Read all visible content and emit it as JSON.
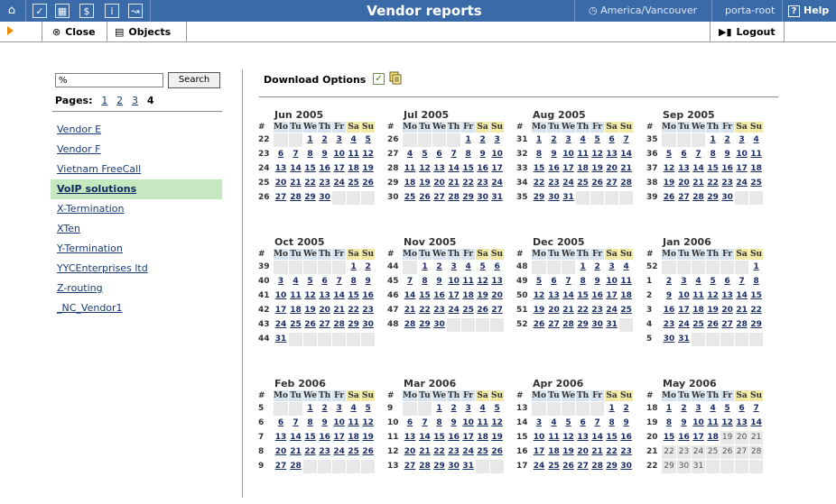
{
  "header": {
    "title": "Vendor reports",
    "timezone": "America/Vancouver",
    "user": "porta-root",
    "help": "Help"
  },
  "toolbar": {
    "close": "Close",
    "objects": "Objects",
    "logout": "Logout"
  },
  "search": {
    "value": "%",
    "button": "Search"
  },
  "pagination": {
    "label": "Pages:",
    "pages": [
      "1",
      "2",
      "3"
    ],
    "current": "4"
  },
  "vendors": [
    "Vendor E",
    "Vendor F",
    "Vietnam FreeCall",
    "VoIP solutions",
    "X-Termination",
    "XTen",
    "Y-Termination",
    "YYCEnterprises ltd",
    "Z-routing",
    "_NC_Vendor1"
  ],
  "selected_vendor": "VoIP solutions",
  "download_options_label": "Download Options",
  "weekday_headers": [
    "#",
    "Mo",
    "Tu",
    "We",
    "Th",
    "Fr",
    "Sa",
    "Su"
  ],
  "months": [
    {
      "title": "Jun 2005",
      "weeks": [
        [
          "22",
          "",
          "",
          "1",
          "2",
          "3",
          "4",
          "5"
        ],
        [
          "23",
          "6",
          "7",
          "8",
          "9",
          "10",
          "11",
          "12"
        ],
        [
          "24",
          "13",
          "14",
          "15",
          "16",
          "17",
          "18",
          "19"
        ],
        [
          "25",
          "20",
          "21",
          "22",
          "23",
          "24",
          "25",
          "26"
        ],
        [
          "26",
          "27",
          "28",
          "29",
          "30",
          "",
          "",
          ""
        ]
      ]
    },
    {
      "title": "Jul 2005",
      "weeks": [
        [
          "26",
          "",
          "",
          "",
          "",
          "1",
          "2",
          "3"
        ],
        [
          "27",
          "4",
          "5",
          "6",
          "7",
          "8",
          "9",
          "10"
        ],
        [
          "28",
          "11",
          "12",
          "13",
          "14",
          "15",
          "16",
          "17"
        ],
        [
          "29",
          "18",
          "19",
          "20",
          "21",
          "22",
          "23",
          "24"
        ],
        [
          "30",
          "25",
          "26",
          "27",
          "28",
          "29",
          "30",
          "31"
        ]
      ]
    },
    {
      "title": "Aug 2005",
      "weeks": [
        [
          "31",
          "1",
          "2",
          "3",
          "4",
          "5",
          "6",
          "7"
        ],
        [
          "32",
          "8",
          "9",
          "10",
          "11",
          "12",
          "13",
          "14"
        ],
        [
          "33",
          "15",
          "16",
          "17",
          "18",
          "19",
          "20",
          "21"
        ],
        [
          "34",
          "22",
          "23",
          "24",
          "25",
          "26",
          "27",
          "28"
        ],
        [
          "35",
          "29",
          "30",
          "31",
          "",
          "",
          "",
          ""
        ]
      ]
    },
    {
      "title": "Sep 2005",
      "weeks": [
        [
          "35",
          "",
          "",
          "",
          "1",
          "2",
          "3",
          "4"
        ],
        [
          "36",
          "5",
          "6",
          "7",
          "8",
          "9",
          "10",
          "11"
        ],
        [
          "37",
          "12",
          "13",
          "14",
          "15",
          "16",
          "17",
          "18"
        ],
        [
          "38",
          "19",
          "20",
          "21",
          "22",
          "23",
          "24",
          "25"
        ],
        [
          "39",
          "26",
          "27",
          "28",
          "29",
          "30",
          "",
          ""
        ]
      ]
    },
    {
      "title": "Oct 2005",
      "weeks": [
        [
          "39",
          "",
          "",
          "",
          "",
          "",
          "1",
          "2"
        ],
        [
          "40",
          "3",
          "4",
          "5",
          "6",
          "7",
          "8",
          "9"
        ],
        [
          "41",
          "10",
          "11",
          "12",
          "13",
          "14",
          "15",
          "16"
        ],
        [
          "42",
          "17",
          "18",
          "19",
          "20",
          "21",
          "22",
          "23"
        ],
        [
          "43",
          "24",
          "25",
          "26",
          "27",
          "28",
          "29",
          "30"
        ],
        [
          "44",
          "31",
          "",
          "",
          "",
          "",
          "",
          ""
        ]
      ]
    },
    {
      "title": "Nov 2005",
      "weeks": [
        [
          "44",
          "",
          "1",
          "2",
          "3",
          "4",
          "5",
          "6"
        ],
        [
          "45",
          "7",
          "8",
          "9",
          "10",
          "11",
          "12",
          "13"
        ],
        [
          "46",
          "14",
          "15",
          "16",
          "17",
          "18",
          "19",
          "20"
        ],
        [
          "47",
          "21",
          "22",
          "23",
          "24",
          "25",
          "26",
          "27"
        ],
        [
          "48",
          "28",
          "29",
          "30",
          "",
          "",
          "",
          ""
        ]
      ]
    },
    {
      "title": "Dec 2005",
      "weeks": [
        [
          "48",
          "",
          "",
          "",
          "1",
          "2",
          "3",
          "4"
        ],
        [
          "49",
          "5",
          "6",
          "7",
          "8",
          "9",
          "10",
          "11"
        ],
        [
          "50",
          "12",
          "13",
          "14",
          "15",
          "16",
          "17",
          "18"
        ],
        [
          "51",
          "19",
          "20",
          "21",
          "22",
          "23",
          "24",
          "25"
        ],
        [
          "52",
          "26",
          "27",
          "28",
          "29",
          "30",
          "31",
          ""
        ]
      ]
    },
    {
      "title": "Jan 2006",
      "weeks": [
        [
          "52",
          "",
          "",
          "",
          "",
          "",
          "",
          "1"
        ],
        [
          "1",
          "2",
          "3",
          "4",
          "5",
          "6",
          "7",
          "8"
        ],
        [
          "2",
          "9",
          "10",
          "11",
          "12",
          "13",
          "14",
          "15"
        ],
        [
          "3",
          "16",
          "17",
          "18",
          "19",
          "20",
          "21",
          "22"
        ],
        [
          "4",
          "23",
          "24",
          "25",
          "26",
          "27",
          "28",
          "29"
        ],
        [
          "5",
          "30",
          "31",
          "",
          "",
          "",
          "",
          ""
        ]
      ]
    },
    {
      "title": "Feb 2006",
      "weeks": [
        [
          "5",
          "",
          "",
          "1",
          "2",
          "3",
          "4",
          "5"
        ],
        [
          "6",
          "6",
          "7",
          "8",
          "9",
          "10",
          "11",
          "12"
        ],
        [
          "7",
          "13",
          "14",
          "15",
          "16",
          "17",
          "18",
          "19"
        ],
        [
          "8",
          "20",
          "21",
          "22",
          "23",
          "24",
          "25",
          "26"
        ],
        [
          "9",
          "27",
          "28",
          "",
          "",
          "",
          "",
          ""
        ]
      ]
    },
    {
      "title": "Mar 2006",
      "weeks": [
        [
          "9",
          "",
          "",
          "1",
          "2",
          "3",
          "4",
          "5"
        ],
        [
          "10",
          "6",
          "7",
          "8",
          "9",
          "10",
          "11",
          "12"
        ],
        [
          "11",
          "13",
          "14",
          "15",
          "16",
          "17",
          "18",
          "19"
        ],
        [
          "12",
          "20",
          "21",
          "22",
          "23",
          "24",
          "25",
          "26"
        ],
        [
          "13",
          "27",
          "28",
          "29",
          "30",
          "31",
          "",
          ""
        ]
      ]
    },
    {
      "title": "Apr 2006",
      "weeks": [
        [
          "13",
          "",
          "",
          "",
          "",
          "",
          "1",
          "2"
        ],
        [
          "14",
          "3",
          "4",
          "5",
          "6",
          "7",
          "8",
          "9"
        ],
        [
          "15",
          "10",
          "11",
          "12",
          "13",
          "14",
          "15",
          "16"
        ],
        [
          "16",
          "17",
          "18",
          "19",
          "20",
          "21",
          "22",
          "23"
        ],
        [
          "17",
          "24",
          "25",
          "26",
          "27",
          "28",
          "29",
          "30"
        ]
      ]
    },
    {
      "title": "May 2006",
      "weeks": [
        [
          "18",
          "1",
          "2",
          "3",
          "4",
          "5",
          "6",
          "7"
        ],
        [
          "19",
          "8",
          "9",
          "10",
          "11",
          "12",
          "13",
          "14"
        ],
        [
          "20",
          "15",
          "16",
          "17",
          "18",
          "19",
          "20",
          "21"
        ],
        [
          "21",
          "22",
          "23",
          "24",
          "25",
          "26",
          "27",
          "28"
        ],
        [
          "22",
          "29",
          "30",
          "31",
          "",
          "",
          "",
          ""
        ]
      ],
      "last_linked_day": 18
    }
  ]
}
